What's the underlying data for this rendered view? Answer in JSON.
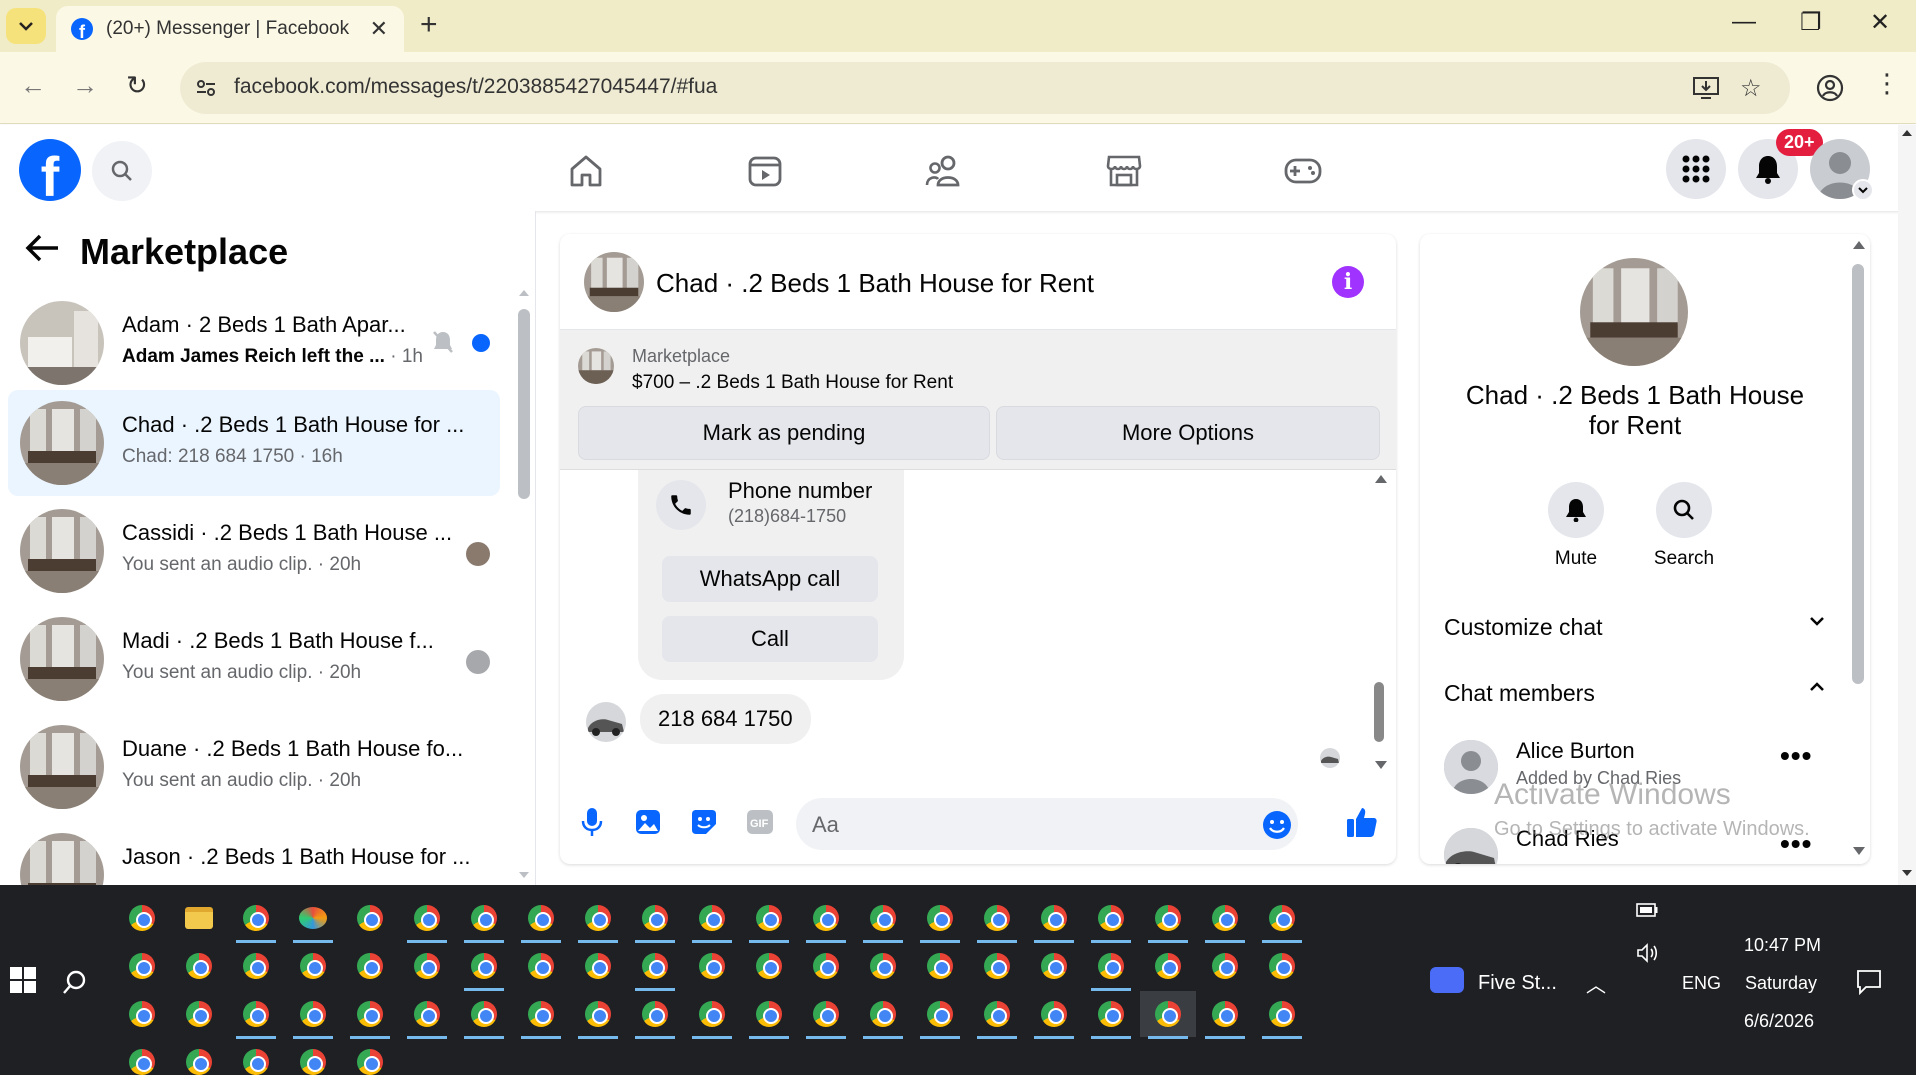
{
  "browser": {
    "tab_title": "(20+) Messenger | Facebook",
    "url": "facebook.com/messages/t/2203885427045447/#fua"
  },
  "header": {
    "notification_badge": "20+"
  },
  "sidebar": {
    "title": "Marketplace",
    "conversations": [
      {
        "name": "Adam · 2 Beds 1 Bath Apar...",
        "preview": "Adam James Reich left the ...",
        "time": "1h",
        "unread": true
      },
      {
        "name": "Chad · .2 Beds 1 Bath House for ...",
        "preview": "Chad: 218 684 1750",
        "time": "16h",
        "active": true
      },
      {
        "name": "Cassidi · .2 Beds 1 Bath House ...",
        "preview": "You sent an audio clip.",
        "time": "20h"
      },
      {
        "name": "Madi · .2 Beds 1 Bath House f...",
        "preview": "You sent an audio clip.",
        "time": "20h"
      },
      {
        "name": "Duane · .2 Beds 1 Bath House fo...",
        "preview": "You sent an audio clip.",
        "time": "20h"
      },
      {
        "name": "Jason · .2 Beds 1 Bath House for ...",
        "preview": "",
        "time": ""
      }
    ]
  },
  "chat": {
    "title": "Chad · .2 Beds 1 Bath House for Rent",
    "marketplace_label": "Marketplace",
    "listing": "$700 – .2 Beds 1 Bath House for Rent",
    "mark_pending": "Mark as pending",
    "more_options": "More Options",
    "contact_card": {
      "title": "Phone number",
      "number": "(218)684-1750",
      "whatsapp": "WhatsApp call",
      "call": "Call"
    },
    "last_message": "218 684 1750",
    "composer_placeholder": "Aa"
  },
  "right_panel": {
    "name": "Chad · .2 Beds 1 Bath House for Rent",
    "mute": "Mute",
    "search": "Search",
    "customize": "Customize chat",
    "members_title": "Chat members",
    "members": [
      {
        "name": "Alice Burton",
        "sub": "Added by Chad Ries"
      },
      {
        "name": "Chad Ries",
        "sub": ""
      }
    ]
  },
  "watermark": {
    "line1": "Activate Windows",
    "line2": "Go to Settings to activate Windows."
  },
  "taskbar": {
    "zoom_label": "Five St...",
    "lang": "ENG",
    "time": "10:47 PM",
    "day": "Saturday",
    "date": "6/6/2026"
  },
  "colors": {
    "fb_blue": "#0866ff",
    "active_conv": "#ebf5ff",
    "info_purple": "#a033ff",
    "badge_red": "#e41e3f"
  }
}
